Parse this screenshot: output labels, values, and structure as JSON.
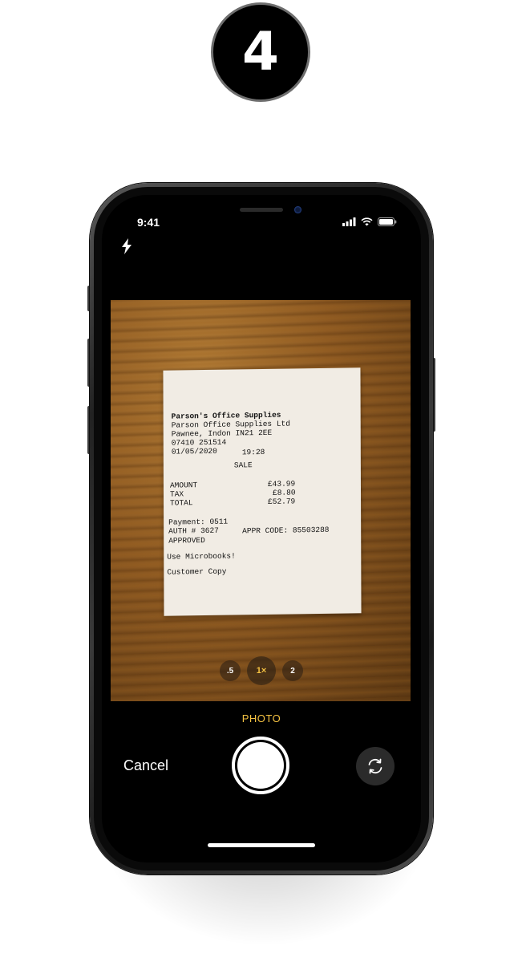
{
  "step_number": "4",
  "status_bar": {
    "time": "9:41"
  },
  "camera": {
    "mode_label": "PHOTO",
    "cancel_label": "Cancel",
    "zoom_options": [
      ".5",
      "1×",
      "2"
    ],
    "active_zoom": "1×",
    "accent_color": "#f5c242"
  },
  "receipt": {
    "store_name": "Parson's Office Supplies",
    "company": "Parson Office Supplies Ltd",
    "address": "Pawnee, Indon IN21 2EE",
    "phone": "07410 251514",
    "date": "01/05/2020",
    "time": "19:28",
    "transaction_type": "SALE",
    "amount_label": "AMOUNT",
    "amount_value": "£43.99",
    "tax_label": "TAX",
    "tax_value": "£8.80",
    "total_label": "TOTAL",
    "total_value": "£52.79",
    "payment": "Payment: 0511",
    "auth": "AUTH # 3627",
    "appr_code": "APPR CODE: 85503288",
    "status": "APPROVED",
    "promo": "Use Microbooks!",
    "copy_type": "Customer Copy"
  },
  "icons": [
    "flash-icon",
    "signal-icon",
    "wifi-icon",
    "battery-icon",
    "switch-camera-icon"
  ]
}
